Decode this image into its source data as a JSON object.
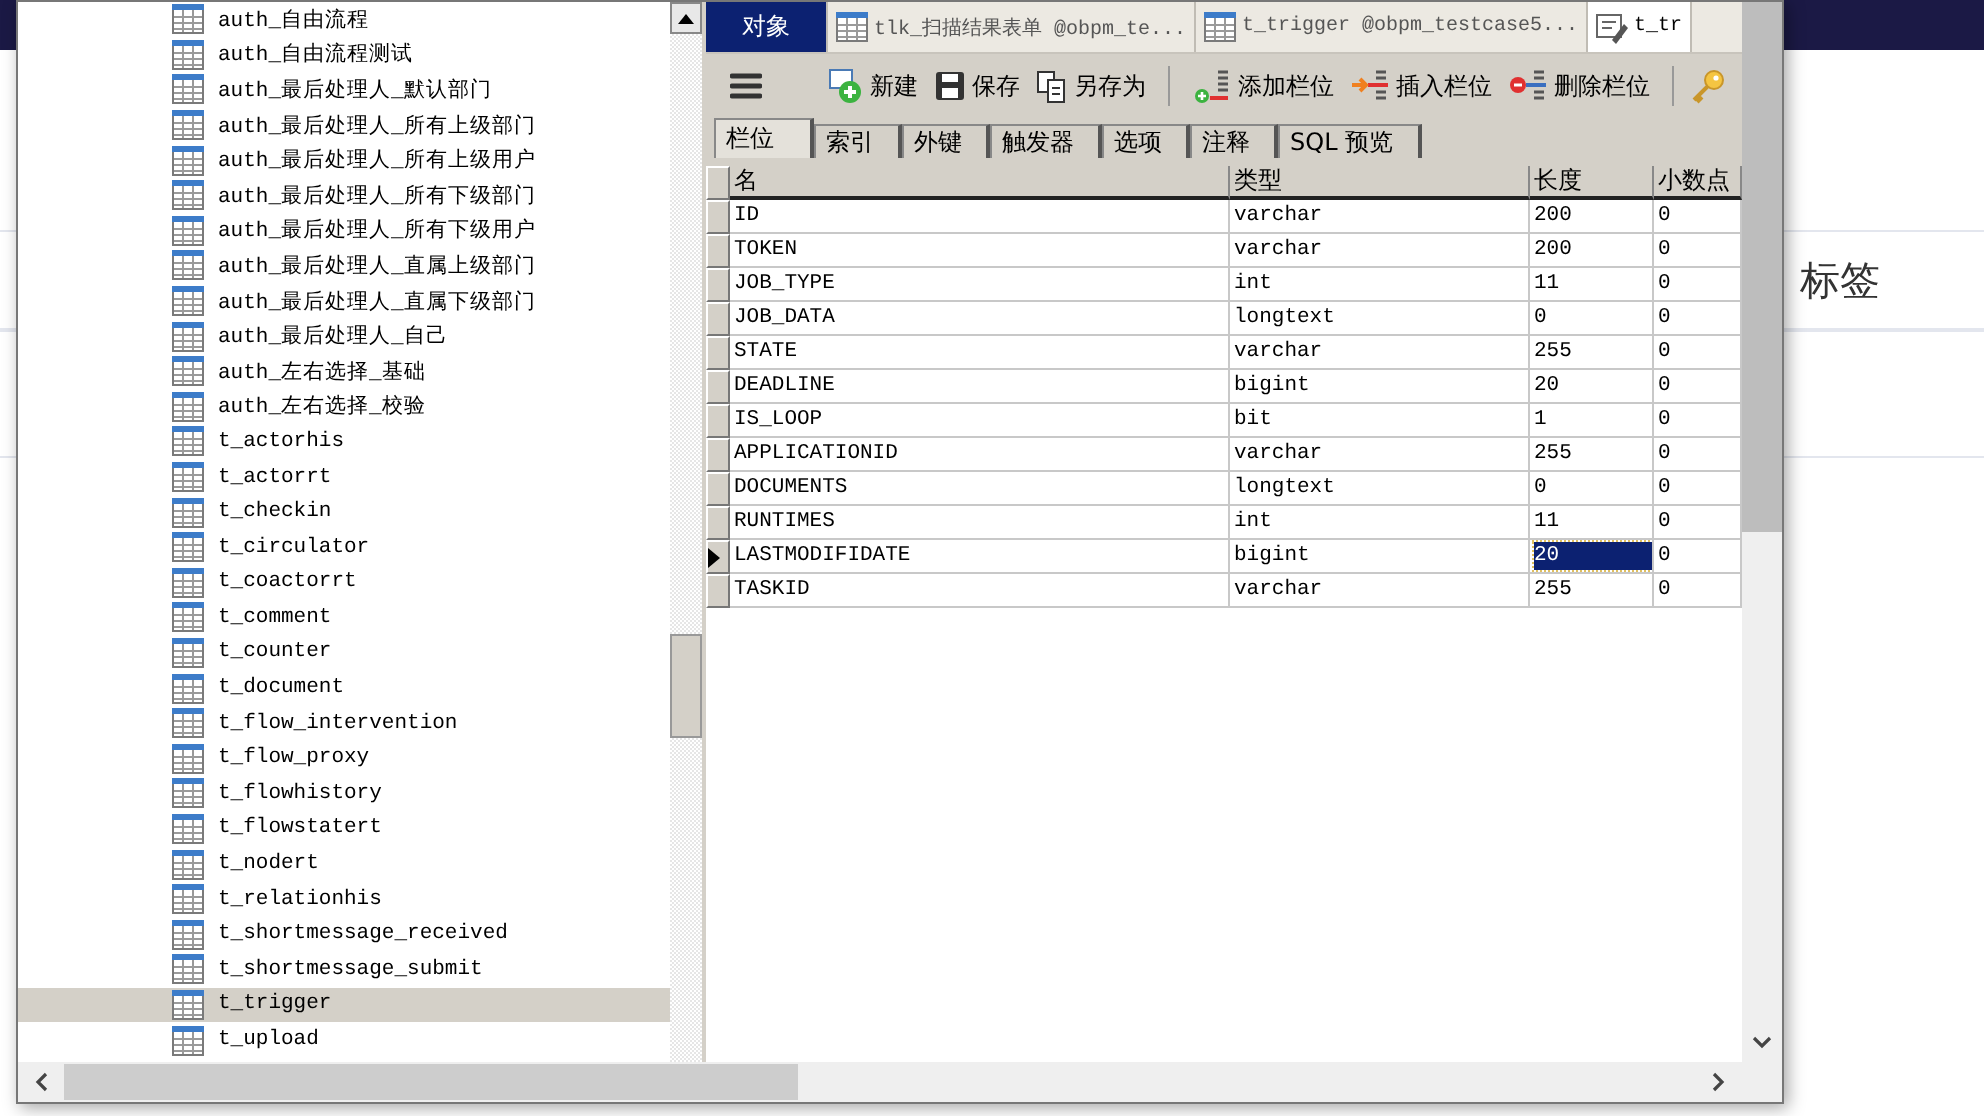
{
  "background_page": {
    "label": "标签"
  },
  "object_tree": {
    "items": [
      {
        "label": "auth_自由流程",
        "selected": false
      },
      {
        "label": "auth_自由流程测试",
        "selected": false
      },
      {
        "label": "auth_最后处理人_默认部门",
        "selected": false
      },
      {
        "label": "auth_最后处理人_所有上级部门",
        "selected": false
      },
      {
        "label": "auth_最后处理人_所有上级用户",
        "selected": false
      },
      {
        "label": "auth_最后处理人_所有下级部门",
        "selected": false
      },
      {
        "label": "auth_最后处理人_所有下级用户",
        "selected": false
      },
      {
        "label": "auth_最后处理人_直属上级部门",
        "selected": false
      },
      {
        "label": "auth_最后处理人_直属下级部门",
        "selected": false
      },
      {
        "label": "auth_最后处理人_自己",
        "selected": false
      },
      {
        "label": "auth_左右选择_基础",
        "selected": false
      },
      {
        "label": "auth_左右选择_校验",
        "selected": false
      },
      {
        "label": "t_actorhis",
        "selected": false
      },
      {
        "label": "t_actorrt",
        "selected": false
      },
      {
        "label": "t_checkin",
        "selected": false
      },
      {
        "label": "t_circulator",
        "selected": false
      },
      {
        "label": "t_coactorrt",
        "selected": false
      },
      {
        "label": "t_comment",
        "selected": false
      },
      {
        "label": "t_counter",
        "selected": false
      },
      {
        "label": "t_document",
        "selected": false
      },
      {
        "label": "t_flow_intervention",
        "selected": false
      },
      {
        "label": "t_flow_proxy",
        "selected": false
      },
      {
        "label": "t_flowhistory",
        "selected": false
      },
      {
        "label": "t_flowstatert",
        "selected": false
      },
      {
        "label": "t_nodert",
        "selected": false
      },
      {
        "label": "t_relationhis",
        "selected": false
      },
      {
        "label": "t_shortmessage_received",
        "selected": false
      },
      {
        "label": "t_shortmessage_submit",
        "selected": false
      },
      {
        "label": "t_trigger",
        "selected": true
      },
      {
        "label": "t_upload",
        "selected": false
      }
    ]
  },
  "editor_tabs": [
    {
      "kind": "objects",
      "label": "对象",
      "selected": false
    },
    {
      "kind": "table",
      "label": "tlk_扫描结果表单 @obpm_te...",
      "selected": false
    },
    {
      "kind": "table",
      "label": "t_trigger @obpm_testcase5...",
      "selected": false
    },
    {
      "kind": "design",
      "label": "t_tr",
      "selected": true
    }
  ],
  "toolbar": [
    {
      "kind": "menu"
    },
    {
      "kind": "new",
      "label": "新建"
    },
    {
      "kind": "save",
      "label": "保存"
    },
    {
      "kind": "save_as",
      "label": "另存为"
    },
    {
      "kind": "separator"
    },
    {
      "kind": "add_field",
      "label": "添加栏位"
    },
    {
      "kind": "insert_field",
      "label": "插入栏位"
    },
    {
      "kind": "delete_field",
      "label": "删除栏位"
    },
    {
      "kind": "separator"
    },
    {
      "kind": "primary_key"
    }
  ],
  "sub_tabs": [
    {
      "label": "栏位",
      "selected": true
    },
    {
      "label": "索引",
      "selected": false
    },
    {
      "label": "外键",
      "selected": false
    },
    {
      "label": "触发器",
      "selected": false
    },
    {
      "label": "选项",
      "selected": false
    },
    {
      "label": "注释",
      "selected": false
    },
    {
      "label": "SQL 预览",
      "selected": false
    }
  ],
  "table": {
    "columns": [
      "名",
      "类型",
      "长度",
      "小数点"
    ],
    "rows": [
      {
        "current": false,
        "cells": [
          {
            "text": "ID",
            "selected": false
          },
          {
            "text": "varchar",
            "selected": false
          },
          {
            "text": "200",
            "selected": false
          },
          {
            "text": "0",
            "selected": false
          }
        ]
      },
      {
        "current": false,
        "cells": [
          {
            "text": "TOKEN",
            "selected": false
          },
          {
            "text": "varchar",
            "selected": false
          },
          {
            "text": "200",
            "selected": false
          },
          {
            "text": "0",
            "selected": false
          }
        ]
      },
      {
        "current": false,
        "cells": [
          {
            "text": "JOB_TYPE",
            "selected": false
          },
          {
            "text": "int",
            "selected": false
          },
          {
            "text": "11",
            "selected": false
          },
          {
            "text": "0",
            "selected": false
          }
        ]
      },
      {
        "current": false,
        "cells": [
          {
            "text": "JOB_DATA",
            "selected": false
          },
          {
            "text": "longtext",
            "selected": false
          },
          {
            "text": "0",
            "selected": false
          },
          {
            "text": "0",
            "selected": false
          }
        ]
      },
      {
        "current": false,
        "cells": [
          {
            "text": "STATE",
            "selected": false
          },
          {
            "text": "varchar",
            "selected": false
          },
          {
            "text": "255",
            "selected": false
          },
          {
            "text": "0",
            "selected": false
          }
        ]
      },
      {
        "current": false,
        "cells": [
          {
            "text": "DEADLINE",
            "selected": false
          },
          {
            "text": "bigint",
            "selected": false
          },
          {
            "text": "20",
            "selected": false
          },
          {
            "text": "0",
            "selected": false
          }
        ]
      },
      {
        "current": false,
        "cells": [
          {
            "text": "IS_LOOP",
            "selected": false
          },
          {
            "text": "bit",
            "selected": false
          },
          {
            "text": "1",
            "selected": false
          },
          {
            "text": "0",
            "selected": false
          }
        ]
      },
      {
        "current": false,
        "cells": [
          {
            "text": "APPLICATIONID",
            "selected": false
          },
          {
            "text": "varchar",
            "selected": false
          },
          {
            "text": "255",
            "selected": false
          },
          {
            "text": "0",
            "selected": false
          }
        ]
      },
      {
        "current": false,
        "cells": [
          {
            "text": "DOCUMENTS",
            "selected": false
          },
          {
            "text": "longtext",
            "selected": false
          },
          {
            "text": "0",
            "selected": false
          },
          {
            "text": "0",
            "selected": false
          }
        ]
      },
      {
        "current": false,
        "cells": [
          {
            "text": "RUNTIMES",
            "selected": false
          },
          {
            "text": "int",
            "selected": false
          },
          {
            "text": "11",
            "selected": false
          },
          {
            "text": "0",
            "selected": false
          }
        ]
      },
      {
        "current": true,
        "cells": [
          {
            "text": "LASTMODIFIDATE",
            "selected": false
          },
          {
            "text": "bigint",
            "selected": false
          },
          {
            "text": "20",
            "selected": true
          },
          {
            "text": "0",
            "selected": false
          }
        ]
      },
      {
        "current": false,
        "cells": [
          {
            "text": "TASKID",
            "selected": false
          },
          {
            "text": "varchar",
            "selected": false
          },
          {
            "text": "255",
            "selected": false
          },
          {
            "text": "0",
            "selected": false
          }
        ]
      }
    ]
  }
}
